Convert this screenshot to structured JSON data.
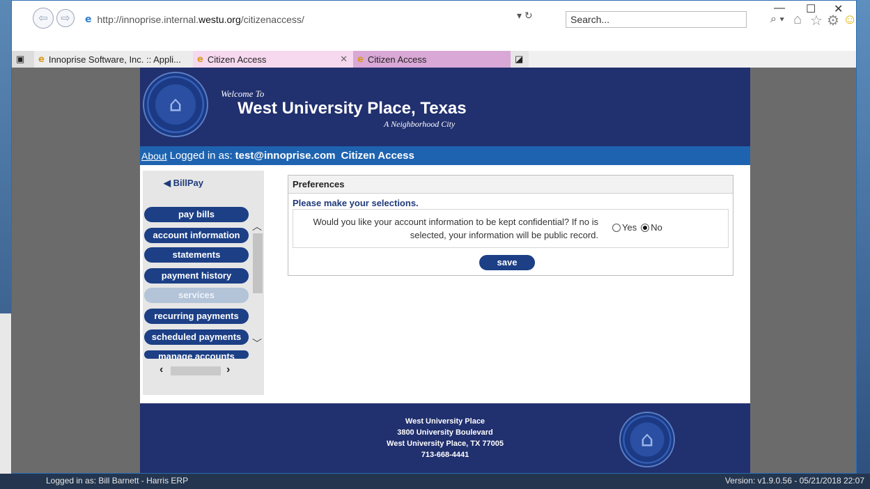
{
  "browser": {
    "url_prefix": "http://innoprise.internal.",
    "url_domain": "westu.org",
    "url_suffix": "/citizenaccess/",
    "addr_tools": "▾ ↻",
    "search_placeholder": "Search...",
    "search_icon": "⌕ ▾",
    "tabs": [
      {
        "label": "Innoprise Software, Inc. :: Appli..."
      },
      {
        "label": "Citizen Access"
      },
      {
        "label": "Citizen Access"
      }
    ],
    "ctrl_min": "—",
    "ctrl_max": "☐",
    "ctrl_close": "✕"
  },
  "banner": {
    "welcome": "Welcome To",
    "city": "West University Place, Texas",
    "tagline": "A Neighborhood City"
  },
  "loginbar": {
    "about": "About",
    "logged_in_as": "Logged in as:",
    "user": "test@innoprise.com",
    "app": "Citizen Access"
  },
  "sidenav": {
    "billpay": "◀  BillPay",
    "items": [
      {
        "label": "pay bills"
      },
      {
        "label": "account information"
      },
      {
        "label": "statements"
      },
      {
        "label": "payment history"
      },
      {
        "label": "services"
      },
      {
        "label": "recurring payments"
      },
      {
        "label": "scheduled payments"
      },
      {
        "label": "manage accounts"
      }
    ]
  },
  "prefs": {
    "header": "Preferences",
    "subheader": "Please make your selections.",
    "question": "Would you like your account information to be kept confidential? If no is selected, your information will be public record.",
    "yes": "Yes",
    "no": "No",
    "selected": "No",
    "save": "save"
  },
  "footer": {
    "line1": "West University Place",
    "line2": "3800 University Boulevard",
    "line3": "West University Place, TX 77005",
    "line4": "713-668-4441"
  },
  "desktop": {
    "status_left": "Logged in as: Bill Barnett - Harris ERP",
    "status_right": "Version: v1.9.0.56 - 05/21/2018 22:07"
  }
}
